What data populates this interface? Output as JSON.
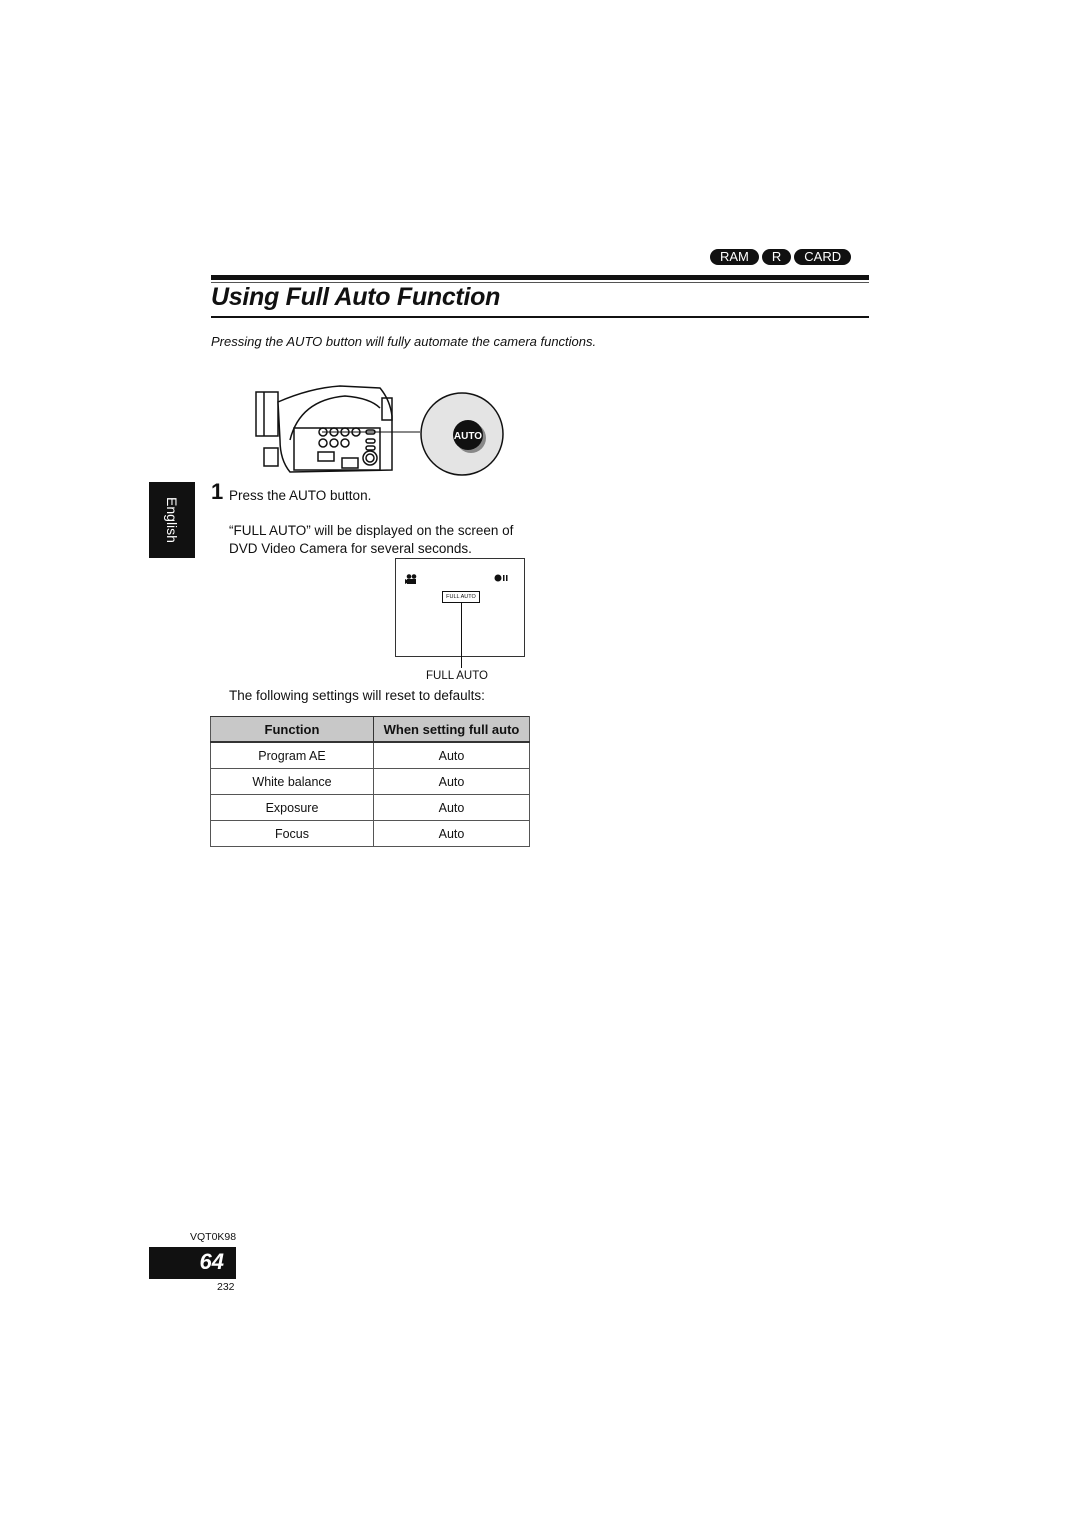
{
  "header": {
    "badges": [
      "RAM",
      "R",
      "CARD"
    ],
    "title": "Using Full Auto Function",
    "subtitle": "Pressing the AUTO button will fully automate the camera functions."
  },
  "sidebar": {
    "language_tab": "English"
  },
  "illustration": {
    "button_label": "AUTO",
    "icons": [
      "camcorder-illustration",
      "auto-button-magnified"
    ]
  },
  "steps": [
    {
      "number": "1",
      "text": "Press the AUTO button.",
      "note": "“FULL AUTO” will be displayed on the screen of DVD Video Camera for several seconds."
    }
  ],
  "screen_display": {
    "indicator_text": "FULL AUTO",
    "callout_label": "FULL AUTO",
    "icons": [
      "movie-camera-icon",
      "record-pause-icon"
    ]
  },
  "defaults_intro": "The following settings will reset to defaults:",
  "settings_table": {
    "headers": [
      "Function",
      "When setting full auto"
    ],
    "rows": [
      [
        "Program AE",
        "Auto"
      ],
      [
        "White balance",
        "Auto"
      ],
      [
        "Exposure",
        "Auto"
      ],
      [
        "Focus",
        "Auto"
      ]
    ]
  },
  "footer": {
    "doc_code": "VQT0K98",
    "page_number": "64",
    "sub_page": "232"
  }
}
